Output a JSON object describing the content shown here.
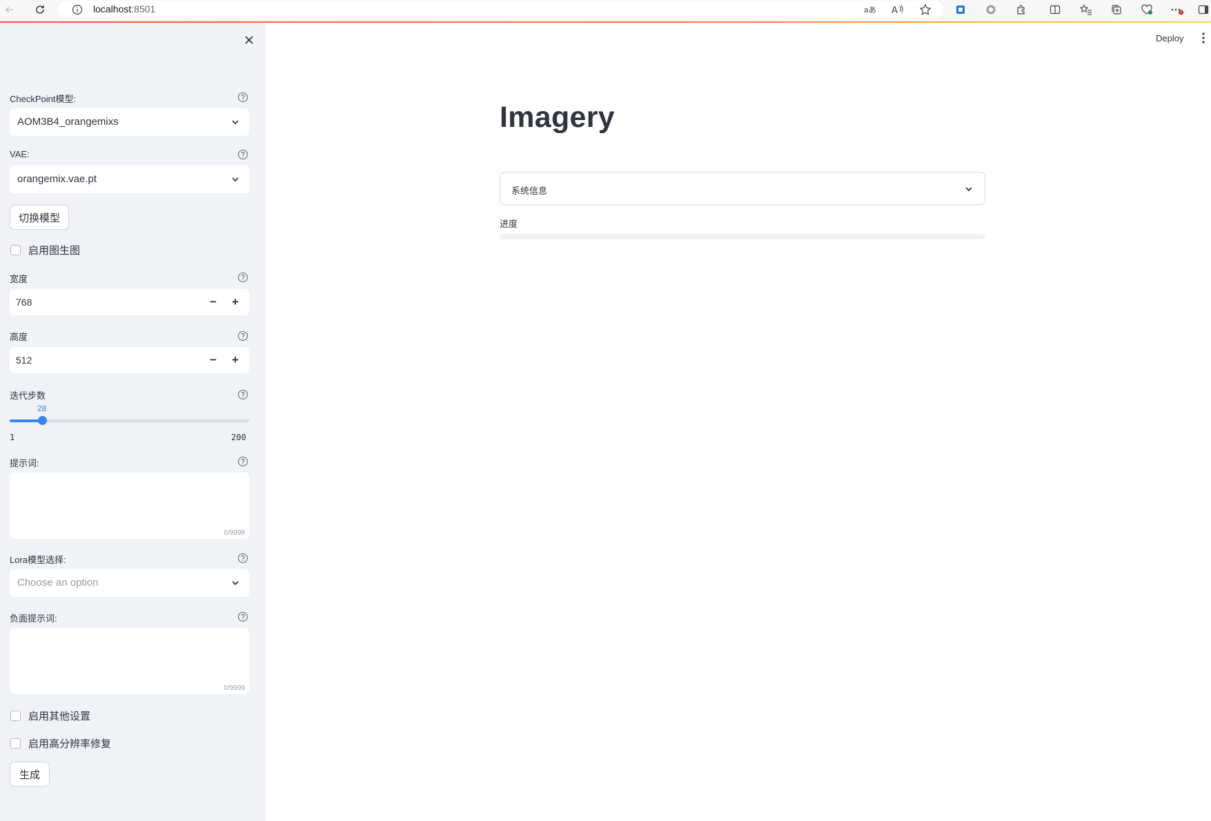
{
  "browser": {
    "url_host": "localhost",
    "url_port": ":8501"
  },
  "sidebar": {
    "checkpoint": {
      "label": "CheckPoint模型:",
      "value": "AOM3B4_orangemixs"
    },
    "vae": {
      "label": "VAE:",
      "value": "orangemix.vae.pt"
    },
    "switch_model_button": "切换模型",
    "img2img_checkbox": {
      "label": "启用图生图",
      "checked": false
    },
    "width": {
      "label": "宽度",
      "value": "768",
      "minus": "−",
      "plus": "+"
    },
    "height": {
      "label": "高度",
      "value": "512",
      "minus": "−",
      "plus": "+"
    },
    "steps": {
      "label": "迭代步数",
      "value": "28",
      "min": "1",
      "max": "200",
      "fraction": 0.1357
    },
    "prompt": {
      "label": "提示词:",
      "count": "0/9999"
    },
    "lora": {
      "label": "Lora模型选择:",
      "placeholder": "Choose an option"
    },
    "negative_prompt": {
      "label": "负面提示词:",
      "count": "0/9999"
    },
    "other_settings_checkbox": {
      "label": "启用其他设置",
      "checked": false
    },
    "hires_fix_checkbox": {
      "label": "启用高分辨率修复",
      "checked": false
    },
    "generate_button": "生成"
  },
  "header": {
    "deploy_label": "Deploy"
  },
  "main": {
    "title": "Imagery",
    "expander_label": "系统信息",
    "progress_label": "进度",
    "progress_fraction": 0
  },
  "colors": {
    "accent": "#3b82f6",
    "sidebar_bg": "#f0f2f6",
    "text": "#31333f"
  }
}
